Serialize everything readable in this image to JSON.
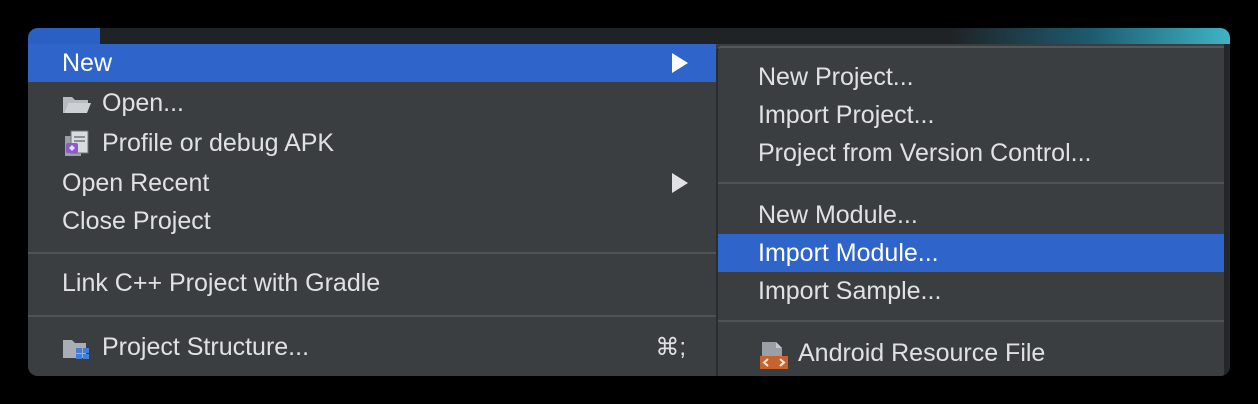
{
  "main_menu": {
    "items": [
      {
        "label": "New",
        "has_submenu": true,
        "selected": true
      },
      {
        "label": "Open...",
        "icon": "folder-open-icon"
      },
      {
        "label": "Profile or debug APK",
        "icon": "apk-debug-icon"
      },
      {
        "label": "Open Recent",
        "has_submenu": true
      },
      {
        "label": "Close Project"
      },
      {
        "label": "Link C++ Project with Gradle"
      },
      {
        "label": "Project Structure...",
        "icon": "project-structure-icon",
        "shortcut": "⌘;"
      }
    ]
  },
  "submenu": {
    "items": [
      {
        "label": "New Project..."
      },
      {
        "label": "Import Project..."
      },
      {
        "label": "Project from Version Control..."
      },
      {
        "label": "New Module..."
      },
      {
        "label": "Import Module...",
        "selected": true
      },
      {
        "label": "Import Sample..."
      },
      {
        "label": "Android Resource File",
        "icon": "android-resource-file-icon"
      }
    ]
  },
  "colors": {
    "menu_bg": "#3b3e40",
    "selection": "#2f65ca",
    "text": "#dfe1e5",
    "separator": "#505356"
  }
}
